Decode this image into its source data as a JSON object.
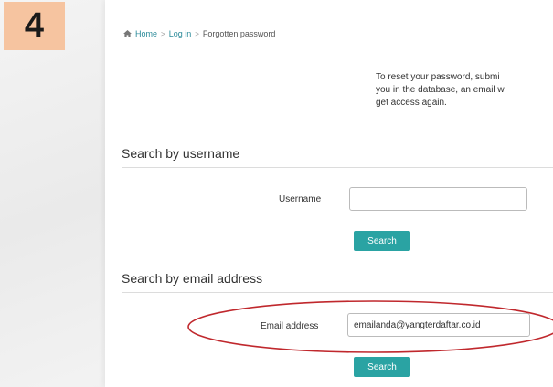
{
  "step_badge": "4",
  "breadcrumb": {
    "home": "Home",
    "login": "Log in",
    "current": "Forgotten password",
    "separator": ">"
  },
  "intro_lines": [
    "To reset your password, submi",
    "you in the database, an email w",
    "get access again."
  ],
  "username_section": {
    "title": "Search by username",
    "label": "Username",
    "value": "",
    "button": "Search"
  },
  "email_section": {
    "title": "Search by email address",
    "label": "Email address",
    "value": "emailanda@yangterdaftar.co.id",
    "button": "Search"
  },
  "colors": {
    "accent": "#2aa3a3",
    "badge": "#f6c4a0",
    "annotation": "#c0282d",
    "link": "#2a8a99"
  }
}
